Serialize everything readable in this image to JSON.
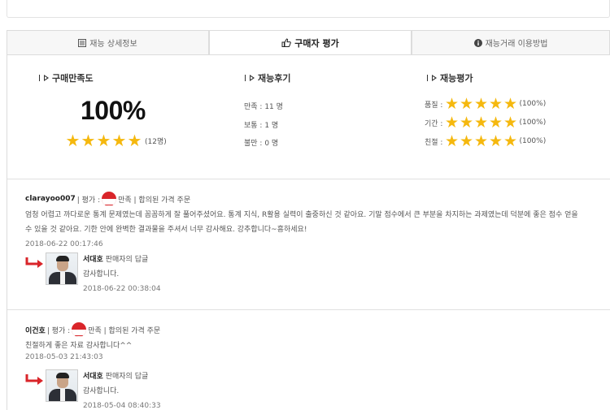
{
  "tabs": [
    {
      "label": "재능 상세정보",
      "icon": "list-icon"
    },
    {
      "label": "구매자 평가",
      "icon": "thumbs-up-icon"
    },
    {
      "label": "재능거래 이용방법",
      "icon": "info-icon"
    }
  ],
  "summary": {
    "satisfaction": {
      "title": "구매만족도",
      "percent": "100%",
      "stars": 5,
      "count": "(12명)"
    },
    "reviews": {
      "title": "재능후기",
      "lines": [
        "만족 : 11 명",
        "보통 : 1 명",
        "불만 : 0 명"
      ]
    },
    "ratings": {
      "title": "재능평가",
      "rows": [
        {
          "label": "품질 :",
          "stars": 5,
          "pct": "(100%)"
        },
        {
          "label": "기간 :",
          "stars": 5,
          "pct": "(100%)"
        },
        {
          "label": "친절 :",
          "stars": 5,
          "pct": "(100%)"
        }
      ]
    }
  },
  "colors": {
    "star": "#f5b80e",
    "face": "#d9252a",
    "arrow": "#d9252a"
  },
  "reviews": [
    {
      "user": "clarayoo007",
      "rating_prefix": "| 평가 :",
      "rating_text": "만족 | 합의된 가격 주문",
      "body": "엄청 어렵고 까다로운 통계 문제였는데 꼼꼼하게 잘 풀어주셨어요. 통계 지식, R활용 실력이 출중하신 것 같아요. 기말 점수에서 큰 부분을 차지하는 과제였는데 덕분에 좋은 점수 얻을 수 있을 것 같아요. 기한 안에 완벽한 결과물을 주셔서 너무 감사해요. 강추합니다~흥하세요!",
      "date": "2018-06-22 00:17:46",
      "reply": {
        "name": "서대호",
        "role": "판매자의 답글",
        "text": "감사합니다.",
        "date": "2018-06-22 00:38:04"
      }
    },
    {
      "user": "이건호",
      "rating_prefix": "| 평가 :",
      "rating_text": "만족 | 합의된 가격 주문",
      "body": "친절하게 좋은 자료 감사합니다^^",
      "date": "2018-05-03 21:43:03",
      "reply": {
        "name": "서대호",
        "role": "판매자의 답글",
        "text": "감사합니다.",
        "date": "2018-05-04 08:40:33"
      }
    }
  ]
}
